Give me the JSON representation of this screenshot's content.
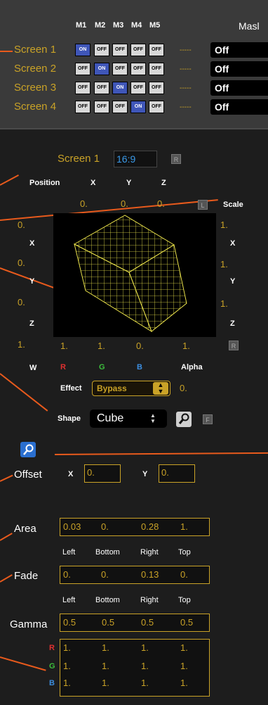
{
  "mask_table": {
    "columns": [
      "M1",
      "M2",
      "M3",
      "M4",
      "M5"
    ],
    "mask_header": "Masl",
    "rows": [
      {
        "label": "Screen 1",
        "toggles": [
          "ON",
          "OFF",
          "OFF",
          "OFF",
          "OFF"
        ],
        "dash": "-----",
        "mask": "Off"
      },
      {
        "label": "Screen 2",
        "toggles": [
          "OFF",
          "ON",
          "OFF",
          "OFF",
          "OFF"
        ],
        "dash": "-----",
        "mask": "Off"
      },
      {
        "label": "Screen 3",
        "toggles": [
          "OFF",
          "OFF",
          "ON",
          "OFF",
          "OFF"
        ],
        "dash": "-----",
        "mask": "Off"
      },
      {
        "label": "Screen 4",
        "toggles": [
          "OFF",
          "OFF",
          "OFF",
          "ON",
          "OFF"
        ],
        "dash": "-----",
        "mask": "Off"
      }
    ]
  },
  "screen": {
    "name": "Screen 1",
    "aspect": "16:9",
    "reset_label": "R"
  },
  "position": {
    "label": "Position",
    "axes": [
      "X",
      "Y",
      "Z"
    ],
    "values": [
      "0.",
      "0.",
      "0."
    ],
    "lock_label": "L"
  },
  "rotation": {
    "axes": [
      "X",
      "Y",
      "Z",
      "W"
    ],
    "values": [
      "0.",
      "0.",
      "0.",
      "1."
    ]
  },
  "scale": {
    "label": "Scale",
    "axes": [
      "X",
      "Y",
      "Z"
    ],
    "values": [
      "1.",
      "1.",
      "1."
    ],
    "reset_label": "R"
  },
  "color": {
    "labels": [
      "R",
      "G",
      "B",
      "Alpha"
    ],
    "values": [
      "1.",
      "1.",
      "0.",
      "1."
    ],
    "label_colors": [
      "#e03030",
      "#3cbf3c",
      "#3c8ee0",
      "#ffffff"
    ]
  },
  "effect": {
    "label": "Effect",
    "value": "Bypass",
    "amount": "0."
  },
  "shape": {
    "label": "Shape",
    "value": "Cube",
    "f_label": "F"
  },
  "offset": {
    "label": "Offset",
    "x_label": "X",
    "x": "0.",
    "y_label": "Y",
    "y": "0."
  },
  "area": {
    "label": "Area",
    "values": [
      "0.03",
      "0.",
      "0.28",
      "1."
    ],
    "sublabels": [
      "Left",
      "Bottom",
      "Right",
      "Top"
    ]
  },
  "fade": {
    "label": "Fade",
    "values": [
      "0.",
      "0.",
      "0.13",
      "0."
    ],
    "sublabels": [
      "Left",
      "Bottom",
      "Right",
      "Top"
    ]
  },
  "gamma": {
    "label": "Gamma",
    "values": [
      "0.5",
      "0.5",
      "0.5",
      "0.5"
    ],
    "rows": [
      {
        "label": "R",
        "color": "#e03030",
        "values": [
          "1.",
          "1.",
          "1.",
          "1."
        ]
      },
      {
        "label": "G",
        "color": "#3cbf3c",
        "values": [
          "1.",
          "1.",
          "1.",
          "1."
        ]
      },
      {
        "label": "B",
        "color": "#3c8ee0",
        "values": [
          "1.",
          "1.",
          "1.",
          "1."
        ]
      }
    ]
  },
  "icons": {
    "search": "magnifier-icon",
    "wrench": "wrench-icon",
    "stepper": "stepper-arrows-icon"
  },
  "colors": {
    "accent": "#c9a227",
    "annotation": "#e85a1c",
    "toggle_on": "#3f56b8"
  }
}
